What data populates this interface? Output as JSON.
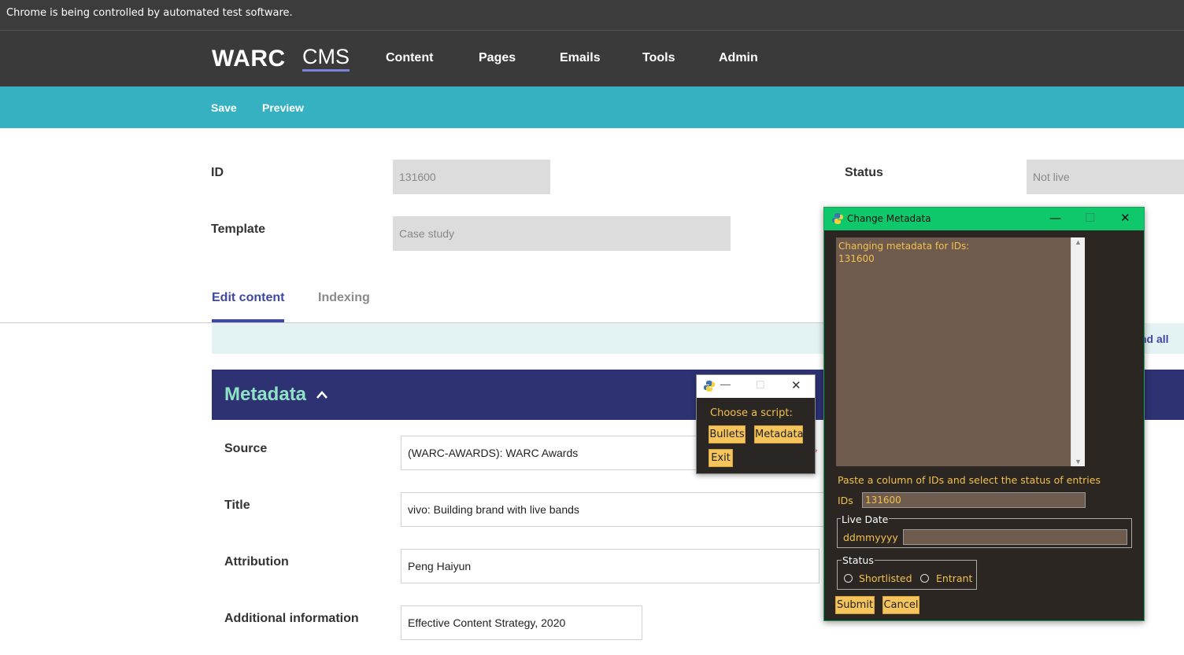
{
  "chrome": {
    "infobar": "Chrome is being controlled by automated test software."
  },
  "brand": {
    "warc": "WARC",
    "cms": "CMS"
  },
  "nav": [
    "Content",
    "Pages",
    "Emails",
    "Tools",
    "Admin"
  ],
  "actions": {
    "save": "Save",
    "preview": "Preview"
  },
  "form": {
    "id_label": "ID",
    "id_value": "131600",
    "status_label": "Status",
    "status_value": "Not live",
    "template_label": "Template",
    "template_value": "Case study"
  },
  "tabs": {
    "edit": "Edit content",
    "indexing": "Indexing"
  },
  "expand_all": "nd all",
  "metadata": {
    "title": "Metadata",
    "source_label": "Source",
    "source_value": "(WARC-AWARDS): WARC Awards",
    "title_label": "Title",
    "title_value": "vivo: Building brand with live bands",
    "attribution_label": "Attribution",
    "attribution_value": "Peng Haiyun",
    "additional_label": "Additional information",
    "additional_value": "Effective Content Strategy, 2020"
  },
  "chooser": {
    "prompt": "Choose a script:",
    "bullets": "Bullets",
    "metadata": "Metadata",
    "exit": "Exit",
    "minimize": "—",
    "maximize": "☐",
    "close": "✕"
  },
  "change_metadata": {
    "title": "Change Metadata",
    "minimize": "—",
    "maximize": "☐",
    "close": "✕",
    "log": "Changing metadata for IDs:\n131600",
    "instruction": "Paste a column of IDs and select the status of entries",
    "ids_label": "IDs",
    "ids_value": "131600",
    "live_date_label": "Live Date",
    "live_date_placeholder": "ddmmyyyy",
    "live_date_value": "",
    "status_label": "Status",
    "shortlisted": "Shortlisted",
    "entrant": "Entrant",
    "submit": "Submit",
    "cancel": "Cancel"
  },
  "colors": {
    "nav_bg": "#3a3a3a",
    "action_bg": "#36b1c2",
    "metadata_bg": "#2e3272",
    "metadata_title": "#8fe2c6",
    "tab_active": "#3e47a4",
    "tk_bg": "#2c2622",
    "tk_text": "#f2c14e",
    "tk_entry": "#6f5b4e",
    "tk_button": "#f5c45c",
    "tk_titlebar": "#10c86c"
  }
}
